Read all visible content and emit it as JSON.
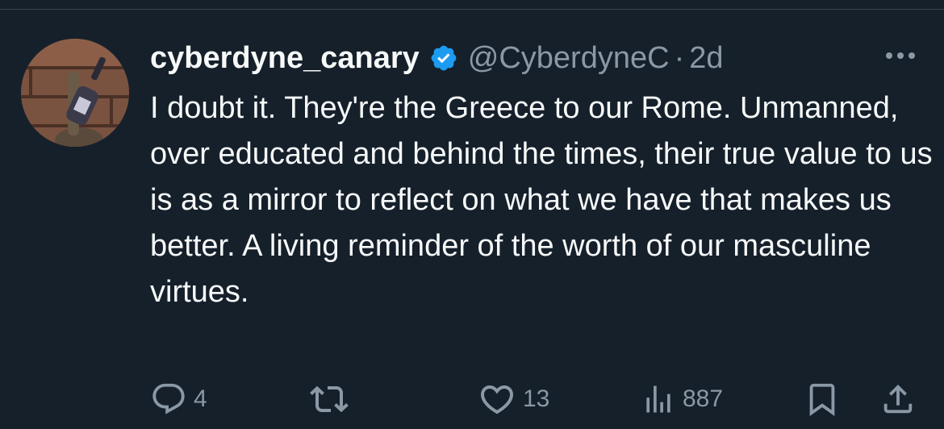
{
  "tweet": {
    "display_name": "cyberdyne_canary",
    "handle": "@CyberdyneC",
    "separator": "·",
    "time": "2d",
    "text": "I doubt it. They're the Greece to our Rome. Unmanned, over educated and behind the times, their true value to us is as a mirror to reflect on what we have that makes us better. A living reminder of the worth of our masculine virtues.",
    "verified": true
  },
  "actions": {
    "replies": "4",
    "retweets": "",
    "likes": "13",
    "views": "887"
  },
  "icons": {
    "verified": "verified-badge-icon",
    "more": "more-horizontal-icon",
    "reply": "reply-icon",
    "retweet": "retweet-icon",
    "like": "heart-icon",
    "views": "views-icon",
    "bookmark": "bookmark-icon",
    "share": "share-icon"
  },
  "colors": {
    "background": "#15202b",
    "primary_text": "#f7f9f9",
    "secondary_text": "#8b98a5",
    "verified_blue": "#1d9bf0"
  }
}
